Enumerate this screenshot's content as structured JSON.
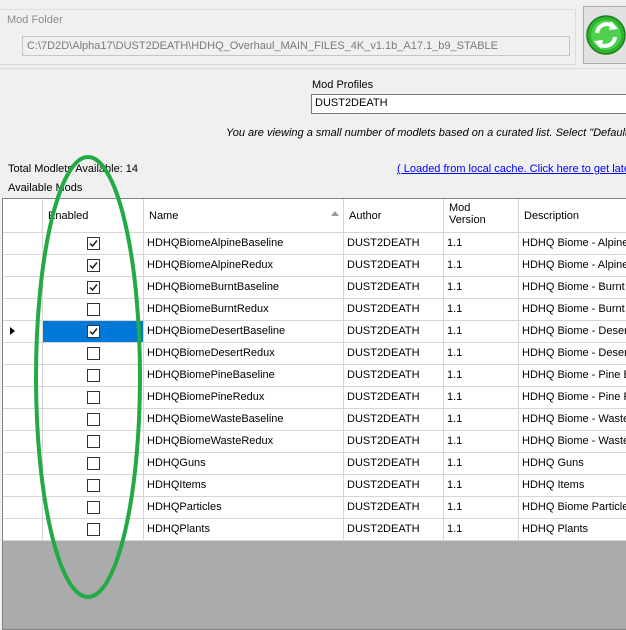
{
  "mod_folder": {
    "legend": "Mod Folder",
    "path": "C:\\7D2D\\Alpha17\\DUST2DEATH\\HDHQ_Overhaul_MAIN_FILES_4K_v1.1b_A17.1_b9_STABLE"
  },
  "profiles": {
    "label": "Mod Profiles",
    "value": "DUST2DEATH"
  },
  "info_text": "You are viewing a small number of modlets based on a curated list.  Select \"Default\" t",
  "total_label": "Total Modlets Available: 14",
  "cache_link": "( Loaded from local cache. Click here to get lates",
  "available_label": "Available Mods",
  "grid": {
    "columns": {
      "enabled": "Enabled",
      "name": "Name",
      "author": "Author",
      "version_line1": "Mod",
      "version_line2": "Version",
      "description": "Description"
    },
    "rows": [
      {
        "enabled": true,
        "name": "HDHQBiomeAlpineBaseline",
        "author": "DUST2DEATH",
        "version": "1.1",
        "description": "HDHQ Biome - Alpine"
      },
      {
        "enabled": true,
        "name": "HDHQBiomeAlpineRedux",
        "author": "DUST2DEATH",
        "version": "1.1",
        "description": "HDHQ Biome - Alpine"
      },
      {
        "enabled": true,
        "name": "HDHQBiomeBurntBaseline",
        "author": "DUST2DEATH",
        "version": "1.1",
        "description": "HDHQ Biome - Burnt B"
      },
      {
        "enabled": false,
        "name": "HDHQBiomeBurntRedux",
        "author": "DUST2DEATH",
        "version": "1.1",
        "description": "HDHQ Biome - Burnt R"
      },
      {
        "enabled": true,
        "name": "HDHQBiomeDesertBaseline",
        "author": "DUST2DEATH",
        "version": "1.1",
        "description": "HDHQ Biome - Desert",
        "current": true
      },
      {
        "enabled": false,
        "name": "HDHQBiomeDesertRedux",
        "author": "DUST2DEATH",
        "version": "1.1",
        "description": "HDHQ Biome - Desert"
      },
      {
        "enabled": false,
        "name": "HDHQBiomePineBaseline",
        "author": "DUST2DEATH",
        "version": "1.1",
        "description": "HDHQ Biome - Pine B"
      },
      {
        "enabled": false,
        "name": "HDHQBiomePineRedux",
        "author": "DUST2DEATH",
        "version": "1.1",
        "description": "HDHQ Biome - Pine Fo"
      },
      {
        "enabled": false,
        "name": "HDHQBiomeWasteBaseline",
        "author": "DUST2DEATH",
        "version": "1.1",
        "description": "HDHQ Biome - Waste"
      },
      {
        "enabled": false,
        "name": "HDHQBiomeWasteRedux",
        "author": "DUST2DEATH",
        "version": "1.1",
        "description": "HDHQ Biome - Waste"
      },
      {
        "enabled": false,
        "name": "HDHQGuns",
        "author": "DUST2DEATH",
        "version": "1.1",
        "description": "HDHQ Guns"
      },
      {
        "enabled": false,
        "name": "HDHQItems",
        "author": "DUST2DEATH",
        "version": "1.1",
        "description": "HDHQ Items"
      },
      {
        "enabled": false,
        "name": "HDHQParticles",
        "author": "DUST2DEATH",
        "version": "1.1",
        "description": "HDHQ Biome Particles"
      },
      {
        "enabled": false,
        "name": "HDHQPlants",
        "author": "DUST2DEATH",
        "version": "1.1",
        "description": "HDHQ Plants"
      }
    ]
  },
  "colors": {
    "selection": "#0078d7",
    "link": "#0000ff",
    "annotation_ellipse": "#22aa44",
    "refresh_icon": "#2db52d"
  },
  "icons": {
    "refresh_button": "refresh-icon",
    "sort": "sort-ascending-icon",
    "row_indicator": "current-row-arrow-icon"
  }
}
